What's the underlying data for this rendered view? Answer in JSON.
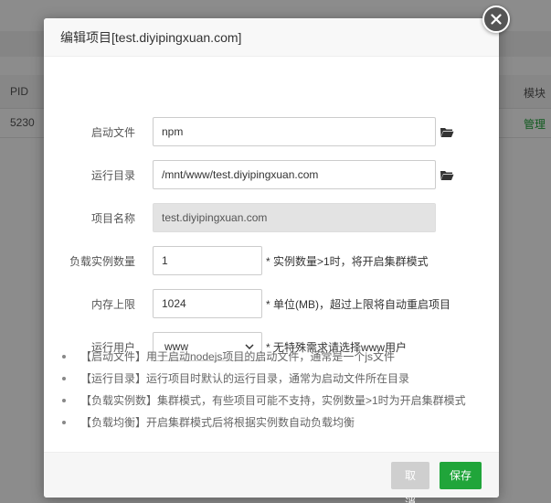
{
  "background": {
    "table_headers": [
      "PID",
      "模块"
    ],
    "row": {
      "pid": "5230",
      "action": "管理"
    }
  },
  "modal": {
    "title": "编辑项目[test.diyipingxuan.com]",
    "fields": {
      "start_file": {
        "label": "启动文件",
        "value": "npm"
      },
      "run_dir": {
        "label": "运行目录",
        "value": "/mnt/www/test.diyipingxuan.com"
      },
      "project_name": {
        "label": "项目名称",
        "value": "test.diyipingxuan.com"
      },
      "instances": {
        "label": "负载实例数量",
        "value": "1",
        "hint": "* 实例数量>1时，将开启集群模式"
      },
      "memory": {
        "label": "内存上限",
        "value": "1024",
        "hint": "* 单位(MB)，超过上限将自动重启项目"
      },
      "run_user": {
        "label": "运行用户",
        "value": "www",
        "hint": "* 无特殊需求请选择www用户"
      }
    },
    "notes": [
      "【启动文件】用于启动nodejs项目的启动文件，通常是一个js文件",
      "【运行目录】运行项目时默认的运行目录，通常为启动文件所在目录",
      "【负载实例数】集群模式，有些项目可能不支持，实例数量>1时为开启集群模式",
      "【负载均衡】开启集群模式后将根据实例数自动负载均衡"
    ],
    "buttons": {
      "cancel": "取消",
      "save": "保存"
    }
  },
  "icons": {
    "close": "close-icon",
    "folder": "folder-icon",
    "dropdown": "chevron-down-icon"
  },
  "colors": {
    "primary": "#20a53a",
    "cancel": "#cfcfcf",
    "disabled_input": "#e3e3e3"
  }
}
